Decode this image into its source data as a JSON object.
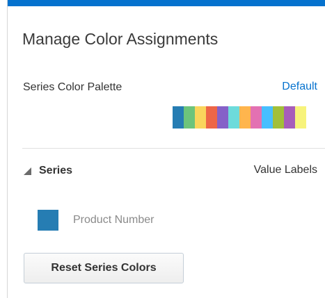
{
  "header": {
    "title": "Manage Color Assignments",
    "accent_color": "#0572ce"
  },
  "palette": {
    "label": "Series Color Palette",
    "link_label": "Default",
    "colors": [
      "#267db3",
      "#6dc47b",
      "#fad55c",
      "#ed6647",
      "#8561c8",
      "#6ddbdb",
      "#ffb54d",
      "#e371b2",
      "#47bfff",
      "#a2bf39",
      "#a75dba",
      "#f7f37b"
    ]
  },
  "series_section": {
    "header_label": "Series",
    "value_labels_label": "Value Labels",
    "items": [
      {
        "name": "Product Number",
        "color": "#267db3"
      }
    ]
  },
  "actions": {
    "reset_label": "Reset Series Colors"
  }
}
